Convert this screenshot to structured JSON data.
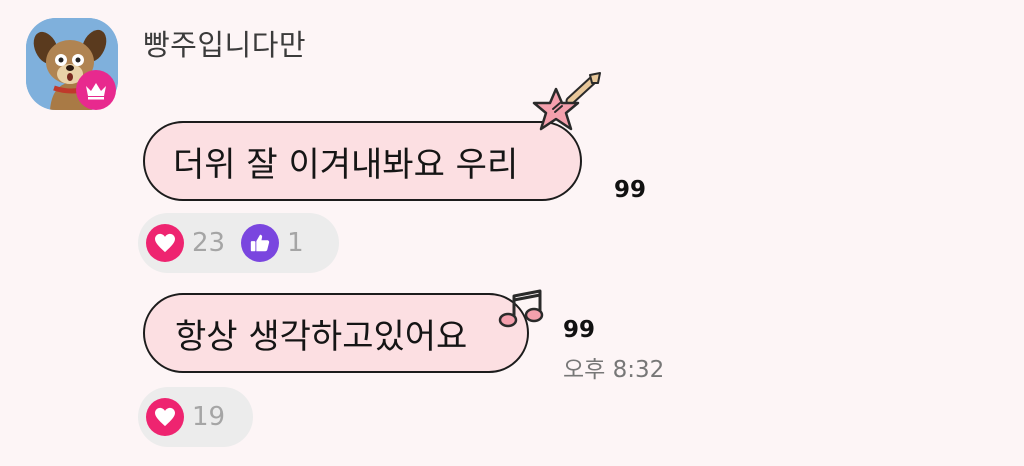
{
  "sender": {
    "name": "빵주입니다만"
  },
  "messages": [
    {
      "text": "더위 잘 이겨내봐요 우리",
      "unread": "99",
      "time": "",
      "sticker": "guitar-icon",
      "reactions": [
        {
          "icon": "heart-icon",
          "count": "23",
          "color": "#ee2470"
        },
        {
          "icon": "thumbs-up-icon",
          "count": "1",
          "color": "#7a46df"
        }
      ]
    },
    {
      "text": "항상 생각하고있어요",
      "unread": "99",
      "time": "오후 8:32",
      "sticker": "music-note-icon",
      "reactions": [
        {
          "icon": "heart-icon",
          "count": "19",
          "color": "#ee2470"
        }
      ]
    }
  ],
  "colors": {
    "background": "#fdf5f6",
    "bubble": "#fcdfe2",
    "bubble_border": "#1c1c1c",
    "badge": "#e8298e",
    "reaction_bar": "#ececec"
  }
}
